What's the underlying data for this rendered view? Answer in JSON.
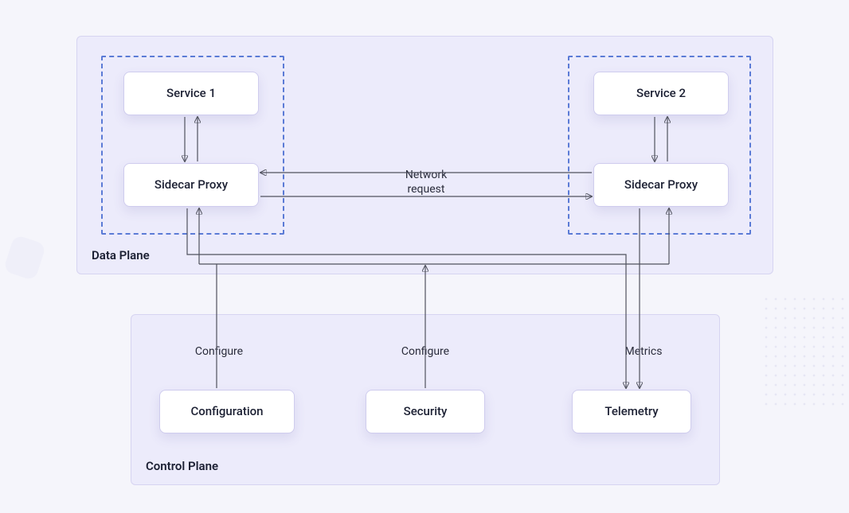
{
  "planes": {
    "data": {
      "label": "Data Plane"
    },
    "control": {
      "label": "Control Plane"
    }
  },
  "nodes": {
    "service1": "Service 1",
    "service2": "Service 2",
    "sidecar1": "Sidecar Proxy",
    "sidecar2": "Sidecar Proxy",
    "configuration": "Configuration",
    "security": "Security",
    "telemetry": "Telemetry"
  },
  "edges": {
    "network_request": "Network\nrequest",
    "configure_left": "Configure",
    "configure_mid": "Configure",
    "metrics": "Metrics"
  }
}
